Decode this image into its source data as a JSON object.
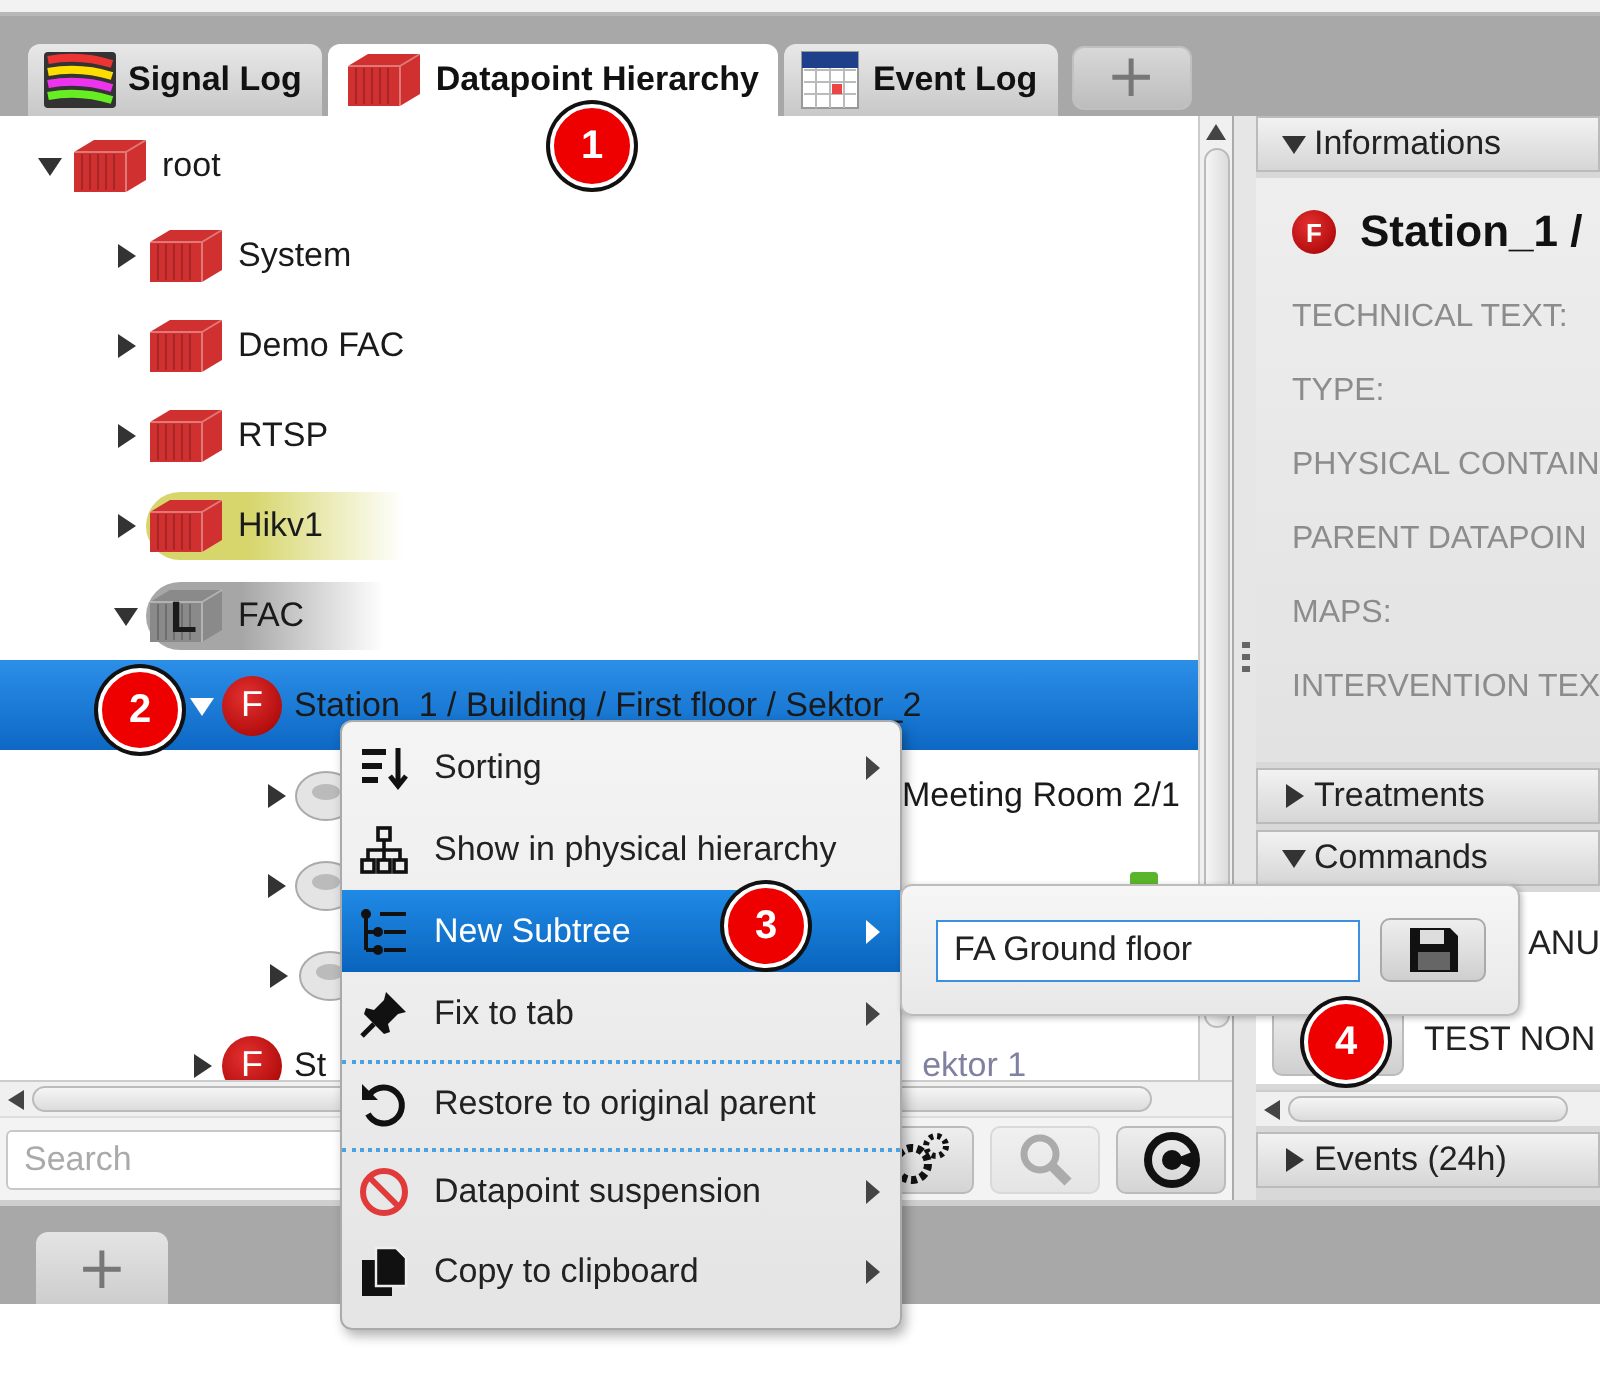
{
  "tabs": [
    {
      "label": "Signal Log",
      "selected": false
    },
    {
      "label": "Datapoint Hierarchy",
      "selected": true
    },
    {
      "label": "Event Log",
      "selected": false
    }
  ],
  "add_tab_button": "+",
  "tree": [
    {
      "label": "root",
      "kind": "site",
      "expanded": true,
      "selected": false,
      "children": [
        {
          "label": "System",
          "kind": "site",
          "expanded": false,
          "selected": false
        },
        {
          "label": "Demo FAC",
          "kind": "site",
          "expanded": false,
          "selected": false
        },
        {
          "label": "RTSP",
          "kind": "site",
          "expanded": false,
          "selected": false
        },
        {
          "label": "Hikv1",
          "kind": "site",
          "expanded": false,
          "selected": false,
          "color": "#d6d66c"
        },
        {
          "label": "FAC",
          "kind": "group",
          "letter": "L",
          "expanded": true,
          "selected": false,
          "color": "#a6a6a6",
          "children": [
            {
              "label": "Station_1 / Building / First floor / Sektor_2",
              "kind": "zone",
              "letter": "F",
              "expanded": true,
              "selected": true,
              "children": [
                {
                  "label": "Meeting Room 2/1",
                  "kind": "detector",
                  "expanded": false,
                  "selected": false
                },
                {
                  "kind": "detector",
                  "expanded": false,
                  "selected": false,
                  "ok": true
                },
                {
                  "kind": "detector",
                  "expanded": false,
                  "selected": false
                }
              ]
            },
            {
              "label": "St",
              "tail": "ektor 1",
              "kind": "zone",
              "letter": "F",
              "expanded": false,
              "selected": false
            }
          ]
        }
      ]
    }
  ],
  "search": {
    "placeholder": "Search"
  },
  "search_buttons": [
    {
      "disabled": false
    },
    {
      "disabled": true
    },
    {
      "disabled": false
    }
  ],
  "context_menu": [
    {
      "label": "Sorting",
      "submenu": true,
      "selected": false,
      "separator_before": false
    },
    {
      "label": "Show in physical hierarchy",
      "submenu": false,
      "selected": false,
      "separator_before": false
    },
    {
      "label": "New Subtree",
      "submenu": true,
      "selected": true,
      "separator_before": false
    },
    {
      "label": "Fix to tab",
      "submenu": true,
      "selected": false,
      "separator_before": false
    },
    {
      "label": "Restore to original parent",
      "submenu": false,
      "selected": false,
      "separator_before": true
    },
    {
      "label": "Datapoint suspension",
      "submenu": true,
      "selected": false,
      "separator_before": true
    },
    {
      "label": "Copy to clipboard",
      "submenu": true,
      "selected": false,
      "separator_before": false
    }
  ],
  "subtree_popup": {
    "value": "FA Ground floor"
  },
  "info_panel": {
    "header": "Informations",
    "expanded": true,
    "letter": "F",
    "title": "Station_1 /",
    "fields": [
      "TECHNICAL TEXT:",
      "TYPE:",
      "PHYSICAL CONTAIN",
      "PARENT DATAPOIN",
      "MAPS:",
      "INTERVENTION TEX"
    ]
  },
  "treatments": {
    "header": "Treatments",
    "expanded": false
  },
  "commands": {
    "header": "Commands",
    "expanded": true,
    "rows": [
      "ANU",
      "TEST NON"
    ]
  },
  "events": {
    "header": "Events (24h)",
    "expanded": false
  },
  "bottom_add_button": "+",
  "callouts": [
    "1",
    "2",
    "3",
    "4"
  ]
}
